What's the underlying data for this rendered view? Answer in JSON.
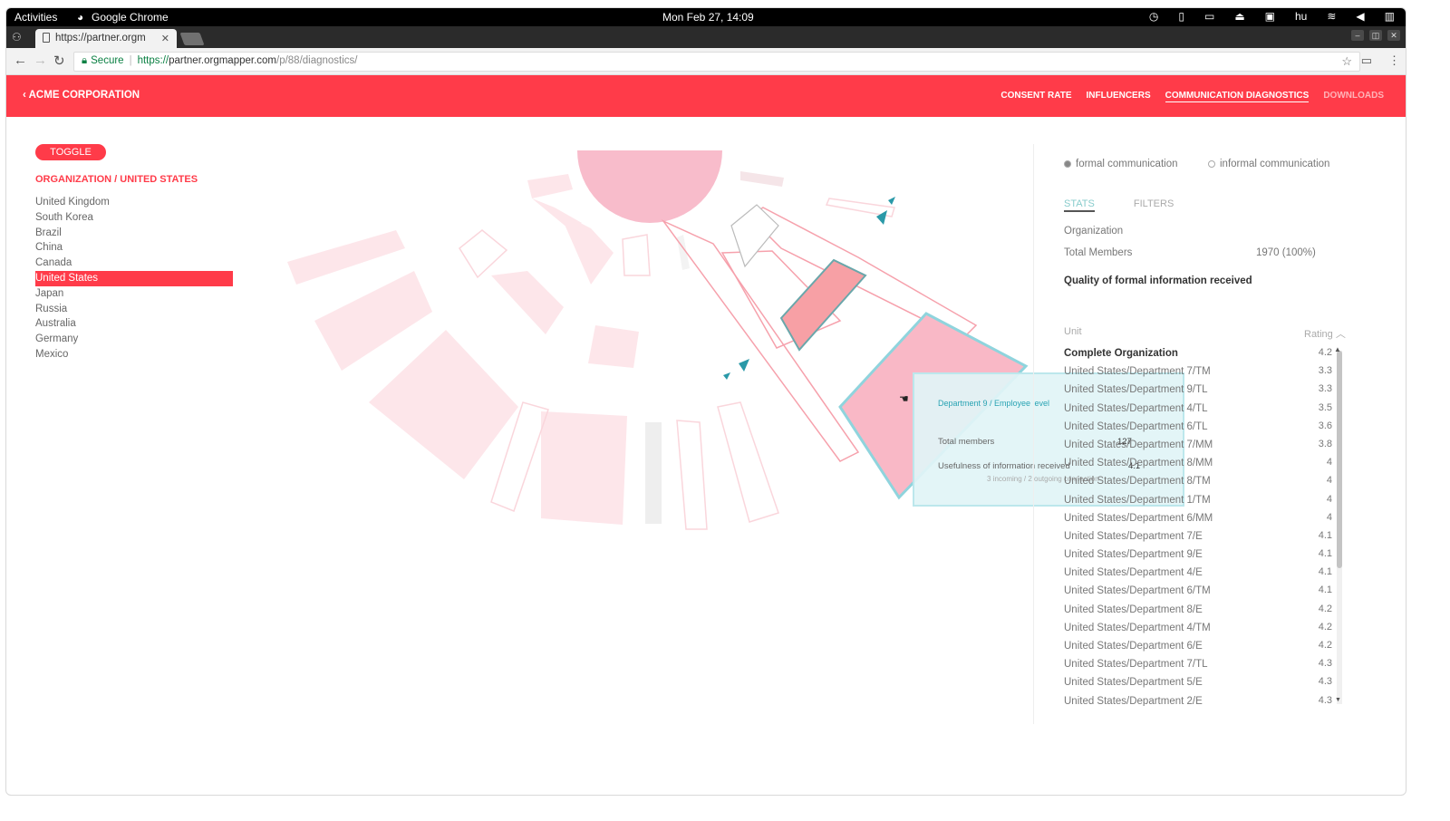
{
  "system_bar": {
    "activities": "Activities",
    "app": "Google Chrome",
    "clock": "Mon Feb 27, 14:09",
    "lang": "hu"
  },
  "browser": {
    "tab_title": "https://partner.orgm",
    "secure_label": "Secure",
    "url_scheme": "https://",
    "url_host": "partner.orgmapper.com",
    "url_path": "/p/88/diagnostics/"
  },
  "header": {
    "back_label": "ACME CORPORATION",
    "nav": [
      "CONSENT RATE",
      "INFLUENCERS",
      "COMMUNICATION DIAGNOSTICS",
      "DOWNLOADS"
    ],
    "active_nav": "COMMUNICATION DIAGNOSTICS",
    "brand_color": "#ff3b49"
  },
  "left": {
    "toggle_label": "TOGGLE",
    "breadcrumb": "ORGANIZATION / UNITED STATES",
    "countries": [
      "United Kingdom",
      "South Korea",
      "Brazil",
      "China",
      "Canada",
      "United States",
      "Japan",
      "Russia",
      "Australia",
      "Germany",
      "Mexico"
    ],
    "selected_country": "United States"
  },
  "tooltip": {
    "title": "Department 9 / Employee level",
    "total_members_label": "Total members",
    "total_members_value": "127",
    "usefulness_label": "Usefulness of information received",
    "usefulness_value": "4.1",
    "connections": "3 incoming / 2 outgoing connection"
  },
  "right": {
    "radio_formal": "formal communication",
    "radio_informal": "informal communication",
    "radio_selected": "formal communication",
    "tab_stats": "STATS",
    "tab_filters": "FILTERS",
    "org_label": "Organization",
    "total_members_label": "Total Members",
    "total_members_value": "1970 (100%)",
    "quality_title": "Quality of formal information received",
    "unit_header": "Unit",
    "rating_header": "Rating",
    "rows": [
      {
        "unit": "Complete Organization",
        "rating": "4.2"
      },
      {
        "unit": "United States/Department 7/TM",
        "rating": "3.3"
      },
      {
        "unit": "United States/Department 9/TL",
        "rating": "3.3"
      },
      {
        "unit": "United States/Department 4/TL",
        "rating": "3.5"
      },
      {
        "unit": "United States/Department 6/TL",
        "rating": "3.6"
      },
      {
        "unit": "United States/Department 7/MM",
        "rating": "3.8"
      },
      {
        "unit": "United States/Department 8/MM",
        "rating": "4"
      },
      {
        "unit": "United States/Department 8/TM",
        "rating": "4"
      },
      {
        "unit": "United States/Department 1/TM",
        "rating": "4"
      },
      {
        "unit": "United States/Department 6/MM",
        "rating": "4"
      },
      {
        "unit": "United States/Department 7/E",
        "rating": "4.1"
      },
      {
        "unit": "United States/Department 9/E",
        "rating": "4.1"
      },
      {
        "unit": "United States/Department 4/E",
        "rating": "4.1"
      },
      {
        "unit": "United States/Department 6/TM",
        "rating": "4.1"
      },
      {
        "unit": "United States/Department 8/E",
        "rating": "4.2"
      },
      {
        "unit": "United States/Department 4/TM",
        "rating": "4.2"
      },
      {
        "unit": "United States/Department 6/E",
        "rating": "4.2"
      },
      {
        "unit": "United States/Department 7/TL",
        "rating": "4.3"
      },
      {
        "unit": "United States/Department 5/E",
        "rating": "4.3"
      },
      {
        "unit": "United States/Department 2/E",
        "rating": "4.3"
      }
    ]
  }
}
